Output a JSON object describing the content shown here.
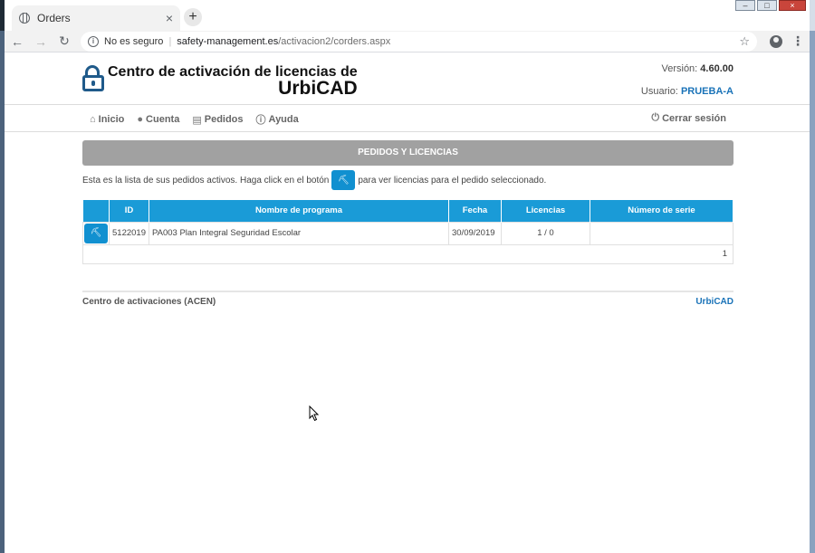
{
  "browser": {
    "tab_title": "Orders",
    "tab_close": "×",
    "new_tab": "+",
    "security_label": "No es seguro",
    "url_host": "safety-management.es",
    "url_path": "/activacion2/corders.aspx"
  },
  "header": {
    "logo_line1": "Centro de activación de licencias de",
    "logo_line2": "UrbiCAD",
    "version_label": "Versión:",
    "version_value": "4.60.00",
    "user_label": "Usuario:",
    "user_value": "PRUEBA-A"
  },
  "nav": {
    "items": [
      {
        "label": "Inicio",
        "icon": "home-icon"
      },
      {
        "label": "Cuenta",
        "icon": "user-icon"
      },
      {
        "label": "Pedidos",
        "icon": "cart-icon"
      },
      {
        "label": "Ayuda",
        "icon": "info-icon"
      }
    ],
    "logout_label": "Cerrar sesión"
  },
  "main": {
    "panel_title": "PEDIDOS Y LICENCIAS",
    "intro_before": "Esta es la lista de sus pedidos activos. Haga click en el botón",
    "intro_after": "para ver licencias para el pedido seleccionado.",
    "table": {
      "headers": [
        "",
        "ID",
        "Nombre de programa",
        "Fecha",
        "Licencias",
        "Número de serie"
      ],
      "rows": [
        {
          "id": "5122019",
          "program": "PA003 Plan Integral Seguridad Escolar",
          "date": "30/09/2019",
          "licenses": "1 / 0",
          "serial": ""
        }
      ],
      "page": "1"
    }
  },
  "footer": {
    "left": "Centro de activaciones (ACEN)",
    "right": "UrbiCAD"
  },
  "colors": {
    "accent": "#1a9bd7",
    "panel_header": "#a1a1a1",
    "link": "#1a73b8"
  }
}
